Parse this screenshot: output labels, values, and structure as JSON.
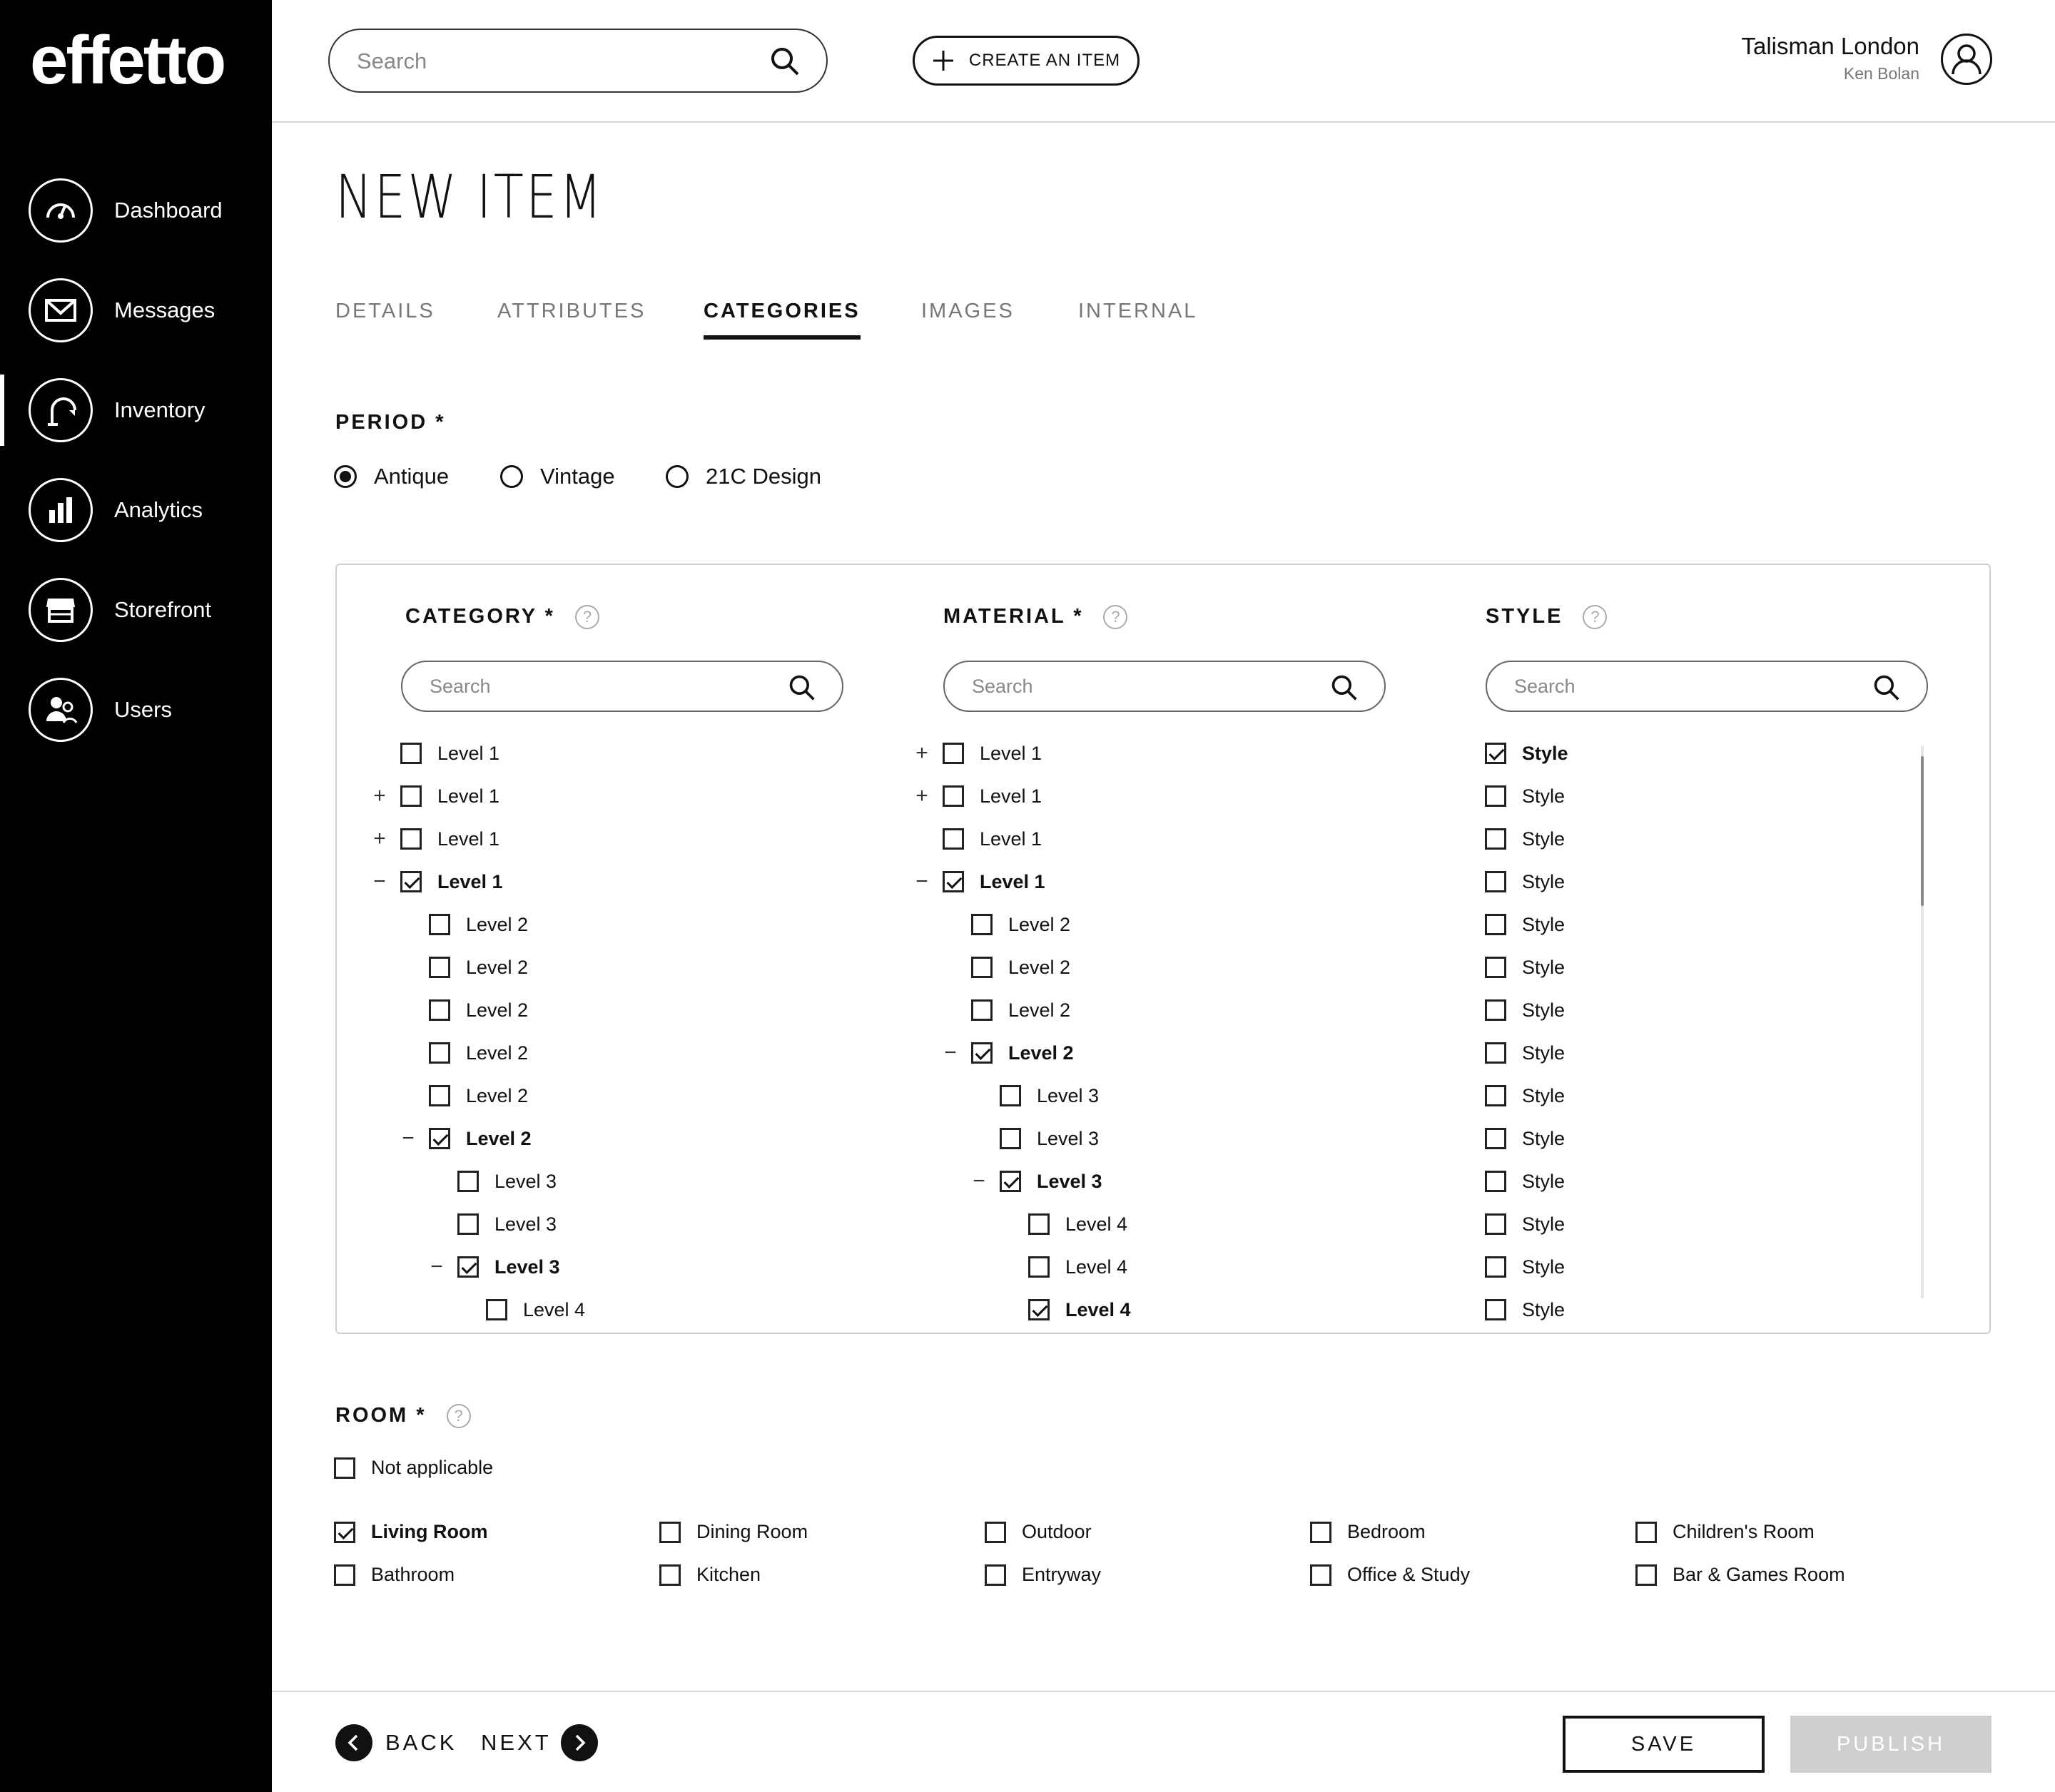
{
  "sidebar": {
    "logo": "effetto",
    "items": [
      {
        "label": "Dashboard",
        "icon": "gauge-icon"
      },
      {
        "label": "Messages",
        "icon": "envelope-icon"
      },
      {
        "label": "Inventory",
        "icon": "lamp-icon"
      },
      {
        "label": "Analytics",
        "icon": "bar-chart-icon"
      },
      {
        "label": "Storefront",
        "icon": "store-icon"
      },
      {
        "label": "Users",
        "icon": "users-icon"
      }
    ],
    "active": "Inventory"
  },
  "topbar": {
    "search_placeholder": "Search",
    "create_label": "CREATE AN ITEM",
    "user_name": "Talisman London",
    "user_sub": "Ken Bolan"
  },
  "page": {
    "title": "NEW ITEM",
    "tabs": [
      {
        "label": "DETAILS"
      },
      {
        "label": "ATTRIBUTES"
      },
      {
        "label": "CATEGORIES"
      },
      {
        "label": "IMAGES"
      },
      {
        "label": "INTERNAL"
      }
    ],
    "active_tab": "CATEGORIES"
  },
  "period": {
    "label": "PERIOD *",
    "options": [
      "Antique",
      "Vintage",
      "21C Design"
    ],
    "selected": "Antique"
  },
  "category": {
    "label": "CATEGORY *",
    "search_placeholder": "Search",
    "rows": [
      {
        "label": "Level 1",
        "level": 1,
        "toggle": "",
        "checked": false
      },
      {
        "label": "Level 1",
        "level": 1,
        "toggle": "+",
        "checked": false
      },
      {
        "label": "Level 1",
        "level": 1,
        "toggle": "+",
        "checked": false
      },
      {
        "label": "Level 1",
        "level": 1,
        "toggle": "−",
        "checked": true
      },
      {
        "label": "Level 2",
        "level": 2,
        "toggle": "",
        "checked": false
      },
      {
        "label": "Level 2",
        "level": 2,
        "toggle": "",
        "checked": false
      },
      {
        "label": "Level 2",
        "level": 2,
        "toggle": "",
        "checked": false
      },
      {
        "label": "Level 2",
        "level": 2,
        "toggle": "",
        "checked": false
      },
      {
        "label": "Level 2",
        "level": 2,
        "toggle": "",
        "checked": false
      },
      {
        "label": "Level 2",
        "level": 2,
        "toggle": "−",
        "checked": true
      },
      {
        "label": "Level 3",
        "level": 3,
        "toggle": "",
        "checked": false
      },
      {
        "label": "Level 3",
        "level": 3,
        "toggle": "",
        "checked": false
      },
      {
        "label": "Level 3",
        "level": 3,
        "toggle": "−",
        "checked": true
      },
      {
        "label": "Level 4",
        "level": 4,
        "toggle": "",
        "checked": false
      }
    ]
  },
  "material": {
    "label": "MATERIAL *",
    "search_placeholder": "Search",
    "rows": [
      {
        "label": "Level 1",
        "level": 1,
        "toggle": "+",
        "checked": false
      },
      {
        "label": "Level 1",
        "level": 1,
        "toggle": "+",
        "checked": false
      },
      {
        "label": "Level 1",
        "level": 1,
        "toggle": "",
        "checked": false
      },
      {
        "label": "Level 1",
        "level": 1,
        "toggle": "−",
        "checked": true
      },
      {
        "label": "Level 2",
        "level": 2,
        "toggle": "",
        "checked": false
      },
      {
        "label": "Level 2",
        "level": 2,
        "toggle": "",
        "checked": false
      },
      {
        "label": "Level 2",
        "level": 2,
        "toggle": "",
        "checked": false
      },
      {
        "label": "Level 2",
        "level": 2,
        "toggle": "−",
        "checked": true
      },
      {
        "label": "Level 3",
        "level": 3,
        "toggle": "",
        "checked": false
      },
      {
        "label": "Level 3",
        "level": 3,
        "toggle": "",
        "checked": false
      },
      {
        "label": "Level 3",
        "level": 3,
        "toggle": "−",
        "checked": true
      },
      {
        "label": "Level 4",
        "level": 4,
        "toggle": "",
        "checked": false
      },
      {
        "label": "Level 4",
        "level": 4,
        "toggle": "",
        "checked": false
      },
      {
        "label": "Level 4",
        "level": 4,
        "toggle": "",
        "checked": true
      }
    ]
  },
  "style": {
    "label": "STYLE",
    "search_placeholder": "Search",
    "rows": [
      {
        "label": "Style",
        "checked": true
      },
      {
        "label": "Style",
        "checked": false
      },
      {
        "label": "Style",
        "checked": false
      },
      {
        "label": "Style",
        "checked": false
      },
      {
        "label": "Style",
        "checked": false
      },
      {
        "label": "Style",
        "checked": false
      },
      {
        "label": "Style",
        "checked": false
      },
      {
        "label": "Style",
        "checked": false
      },
      {
        "label": "Style",
        "checked": false
      },
      {
        "label": "Style",
        "checked": false
      },
      {
        "label": "Style",
        "checked": false
      },
      {
        "label": "Style",
        "checked": false
      },
      {
        "label": "Style",
        "checked": false
      },
      {
        "label": "Style",
        "checked": false
      }
    ]
  },
  "room": {
    "label": "ROOM *",
    "not_applicable": "Not applicable",
    "options": [
      {
        "label": "Living Room",
        "checked": true
      },
      {
        "label": "Dining Room",
        "checked": false
      },
      {
        "label": "Outdoor",
        "checked": false
      },
      {
        "label": "Bedroom",
        "checked": false
      },
      {
        "label": "Children's Room",
        "checked": false
      },
      {
        "label": "Bathroom",
        "checked": false
      },
      {
        "label": "Kitchen",
        "checked": false
      },
      {
        "label": "Entryway",
        "checked": false
      },
      {
        "label": "Office & Study",
        "checked": false
      },
      {
        "label": "Bar & Games Room",
        "checked": false
      }
    ]
  },
  "footer": {
    "back_label": "BACK",
    "next_label": "NEXT",
    "save_label": "SAVE",
    "publish_label": "PUBLISH"
  },
  "colors": {
    "sidebar_bg": "#000000",
    "accent": "#111111",
    "disabled": "#cfcfcf"
  }
}
